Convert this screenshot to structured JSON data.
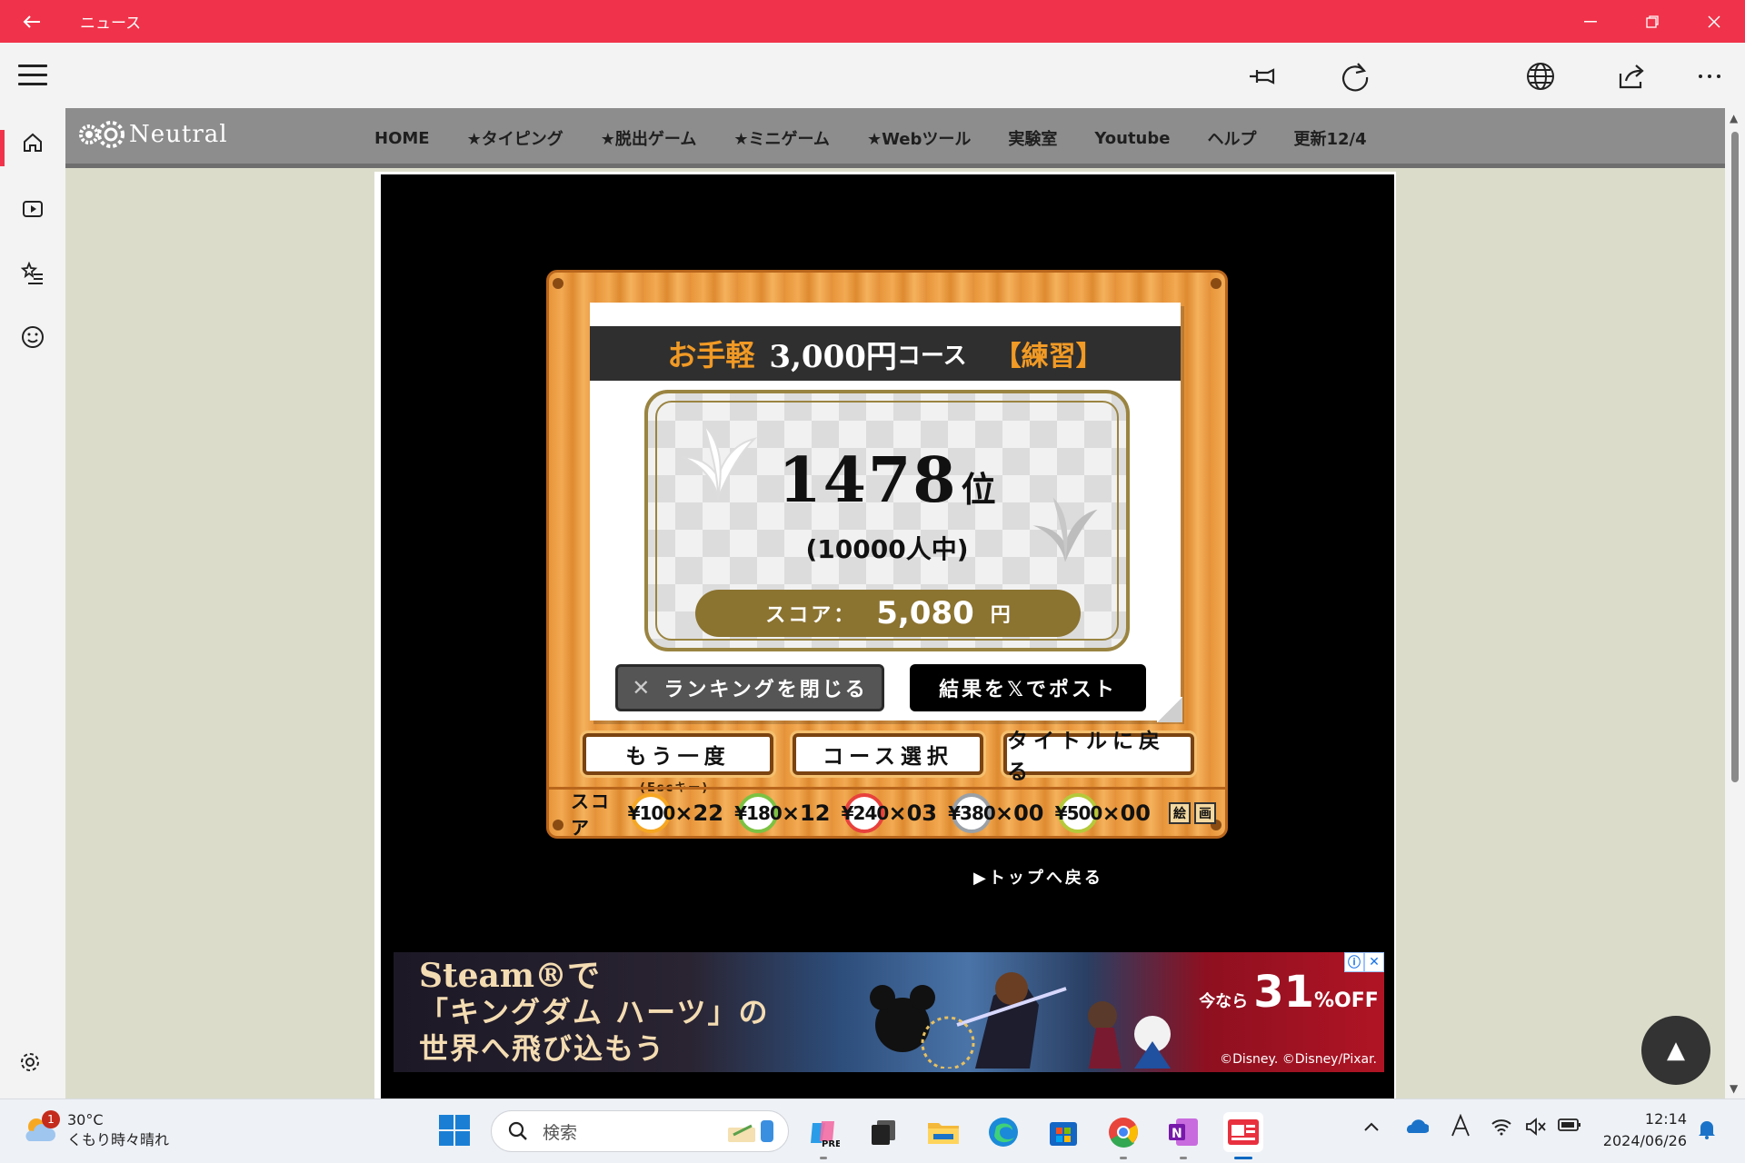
{
  "window": {
    "title": "ニュース",
    "buttons": [
      "minimize",
      "restore",
      "close"
    ],
    "accent": "#f0334a"
  },
  "toolbar": {
    "icons": [
      "pin-icon",
      "refresh-icon",
      "dark-mode-icon",
      "globe-icon",
      "share-icon",
      "more-icon"
    ]
  },
  "rail": {
    "items": [
      "home-icon",
      "video-icon",
      "favorites-icon",
      "emoji-icon"
    ],
    "active": "home-icon"
  },
  "site": {
    "logo": "Neutral",
    "nav": [
      "HOME",
      "★タイピング",
      "★脱出ゲーム",
      "★ミニゲーム",
      "★Webツール",
      "実験室",
      "Youtube",
      "ヘルプ",
      "更新12/4"
    ]
  },
  "game": {
    "course_prefix": "お手軽",
    "course_amount": "3,000円",
    "course_suffix": "コース",
    "course_mode": "【練習】",
    "rank_number": "1478",
    "rank_unit": "位",
    "out_of": "(10000人中)",
    "score_label": "スコア：",
    "score_value": "5,080",
    "score_unit": "円",
    "close_ranking": "ランキングを閉じる",
    "post_result": "結果を𝕏でポスト",
    "retry": "もう一度",
    "esc_hint": "(Escキー)",
    "course_select": "コース選択",
    "back_to_title": "タイトルに戻る",
    "coin_label": "スコア",
    "coins": [
      {
        "label": "¥100",
        "count": "×22",
        "ring": "#f5a623"
      },
      {
        "label": "¥180",
        "count": "×12",
        "ring": "#7cc242"
      },
      {
        "label": "¥240",
        "count": "×03",
        "ring": "#e8413c"
      },
      {
        "label": "¥380",
        "count": "×00",
        "ring": "#9aa0a6"
      },
      {
        "label": "¥500",
        "count": "×00",
        "ring": "#b5c93a"
      }
    ],
    "seals": [
      "絵",
      "画"
    ],
    "back_to_top": "▶トップへ戻る"
  },
  "ad": {
    "line1": "Steam®で",
    "line2": "「キングダム ハーツ」の",
    "line3": "世界へ飛び込もう",
    "sale_prefix": "今なら",
    "sale_number": "31",
    "sale_suffix": "%OFF",
    "copyright": "©Disney. ©Disney/Pixar."
  },
  "fab": "▲",
  "taskbar": {
    "temperature": "30°C",
    "weather": "くもり時々晴れ",
    "notification_count": "1",
    "search_placeholder": "検索",
    "time": "12:14",
    "date": "2024/06/26",
    "apps": [
      "copilot-icon",
      "task-view-icon",
      "file-explorer-icon",
      "edge-icon",
      "store-icon",
      "chrome-icon",
      "onenote-icon",
      "news-app-icon"
    ]
  }
}
